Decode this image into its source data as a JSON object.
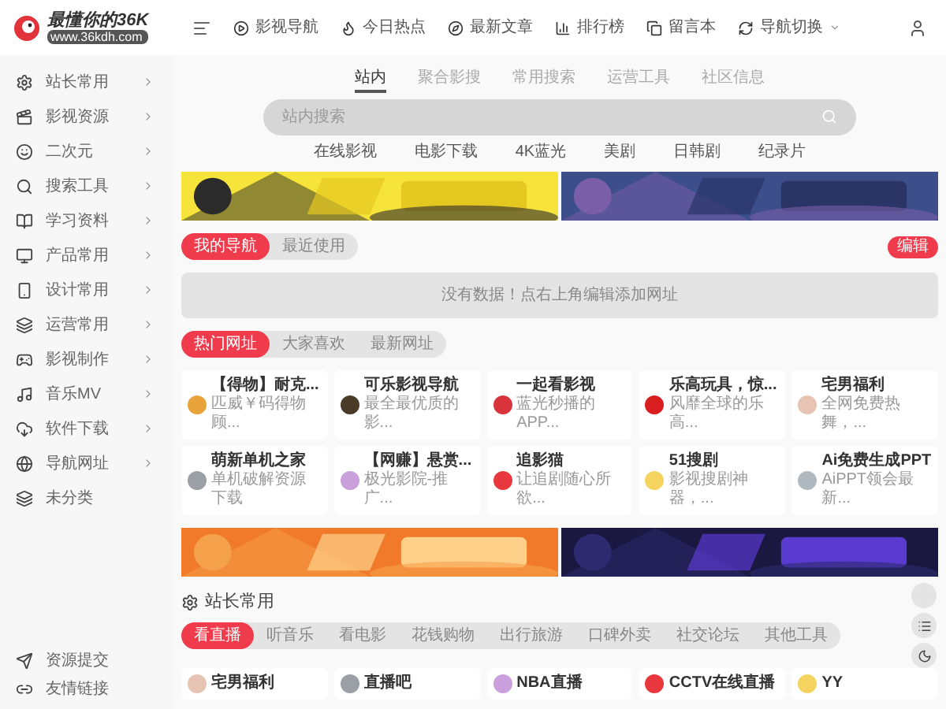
{
  "logo": {
    "title": "最懂你的36K",
    "url": "www.36kdh.com"
  },
  "sidebar": {
    "items": [
      {
        "label": "站长常用",
        "submenu": true
      },
      {
        "label": "影视资源",
        "submenu": true
      },
      {
        "label": "二次元",
        "submenu": true
      },
      {
        "label": "搜索工具",
        "submenu": true
      },
      {
        "label": "学习资料",
        "submenu": true
      },
      {
        "label": "产品常用",
        "submenu": true
      },
      {
        "label": "设计常用",
        "submenu": true
      },
      {
        "label": "运营常用",
        "submenu": true
      },
      {
        "label": "影视制作",
        "submenu": true
      },
      {
        "label": "音乐MV",
        "submenu": true
      },
      {
        "label": "软件下载",
        "submenu": true
      },
      {
        "label": "导航网址",
        "submenu": true
      },
      {
        "label": "未分类",
        "submenu": false
      }
    ],
    "footer": [
      "资源提交",
      "友情链接"
    ]
  },
  "topbar": {
    "items": [
      {
        "label": "影视导航",
        "dropdown": false
      },
      {
        "label": "今日热点",
        "dropdown": false
      },
      {
        "label": "最新文章",
        "dropdown": false
      },
      {
        "label": "排行榜",
        "dropdown": false
      },
      {
        "label": "留言本",
        "dropdown": false
      },
      {
        "label": "导航切换",
        "dropdown": true
      }
    ]
  },
  "search": {
    "tabs": [
      {
        "label": "站内",
        "selected": true
      },
      {
        "label": "聚合影搜",
        "selected": false
      },
      {
        "label": "常用搜索",
        "selected": false
      },
      {
        "label": "运营工具",
        "selected": false
      },
      {
        "label": "社区信息",
        "selected": false
      }
    ],
    "placeholder": "站内搜索",
    "quick_links": [
      "在线影视",
      "电影下载",
      "4K蓝光",
      "美剧",
      "日韩剧",
      "纪录片"
    ]
  },
  "my_nav": {
    "tabs": [
      {
        "label": "我的导航",
        "selected": true
      },
      {
        "label": "最近使用",
        "selected": false
      }
    ],
    "edit": "编辑",
    "empty": "没有数据！点右上角编辑添加网址"
  },
  "hot": {
    "tabs": [
      {
        "label": "热门网址",
        "selected": true
      },
      {
        "label": "大家喜欢",
        "selected": false
      },
      {
        "label": "最新网址",
        "selected": false
      }
    ],
    "cards": [
      {
        "title": "【得物】耐克...",
        "desc": "匹威￥码得物顾..."
      },
      {
        "title": "可乐影视导航",
        "desc": "最全最优质的影..."
      },
      {
        "title": "一起看影视",
        "desc": "蓝光秒播的APP..."
      },
      {
        "title": "乐高玩具，惊...",
        "desc": "风靡全球的乐高..."
      },
      {
        "title": "宅男福利",
        "desc": "全网免费热舞，..."
      },
      {
        "title": "萌新单机之家",
        "desc": "单机破解资源下载"
      },
      {
        "title": "【网赚】悬赏...",
        "desc": "极光影院-推广..."
      },
      {
        "title": "追影猫",
        "desc": "让追剧随心所欲..."
      },
      {
        "title": "51搜剧",
        "desc": "影视搜剧神器，..."
      },
      {
        "title": "Ai免费生成PPT",
        "desc": "AiPPT领会最新..."
      }
    ]
  },
  "section": {
    "title": "站长常用",
    "tabs": [
      {
        "label": "看直播",
        "selected": true
      },
      {
        "label": "听音乐",
        "selected": false
      },
      {
        "label": "看电影",
        "selected": false
      },
      {
        "label": "花钱购物",
        "selected": false
      },
      {
        "label": "出行旅游",
        "selected": false
      },
      {
        "label": "口碑外卖",
        "selected": false
      },
      {
        "label": "社交论坛",
        "selected": false
      },
      {
        "label": "其他工具",
        "selected": false
      }
    ],
    "cards": [
      {
        "title": "宅男福利"
      },
      {
        "title": "直播吧"
      },
      {
        "title": "NBA直播"
      },
      {
        "title": "CCTV在线直播"
      },
      {
        "title": "YY"
      }
    ]
  }
}
